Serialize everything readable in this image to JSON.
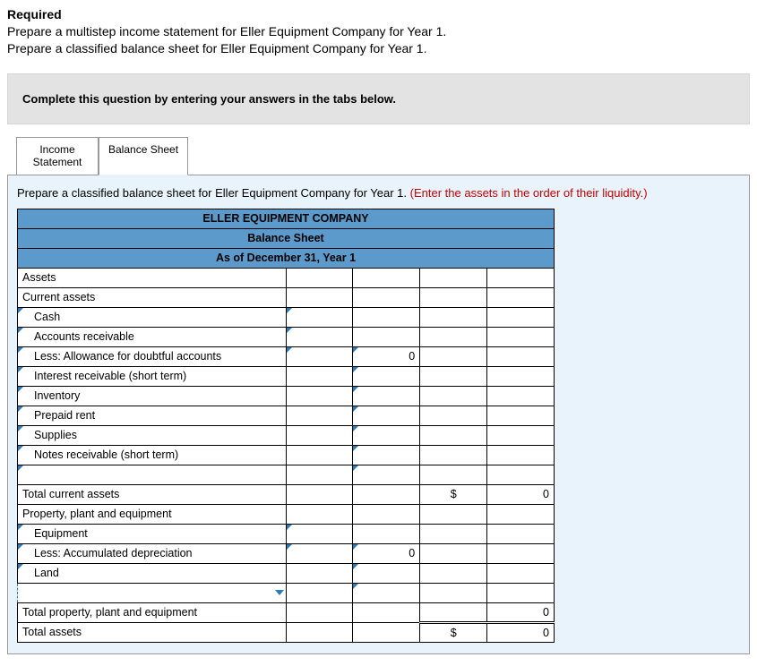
{
  "required": {
    "heading": "Required",
    "line1": "Prepare a multistep income statement for Eller Equipment Company for Year 1.",
    "line2": "Prepare a classified balance sheet for Eller Equipment Company for Year 1."
  },
  "instruction": "Complete this question by entering your answers in the tabs below.",
  "tabs": {
    "income": "Income Statement",
    "balance": "Balance Sheet"
  },
  "panel_prompt": "Prepare a classified balance sheet for Eller Equipment Company for Year 1. ",
  "panel_prompt_red": "(Enter the assets in the order of their liquidity.)",
  "headers": {
    "company": "ELLER EQUIPMENT COMPANY",
    "title": "Balance Sheet",
    "asof": "As of December 31, Year 1"
  },
  "rows": {
    "assets": "Assets",
    "current_assets": "Current assets",
    "cash": "Cash",
    "ar": "Accounts receivable",
    "less_allow": "Less: Allowance for doubtful accounts",
    "int_recv": "Interest receivable (short term)",
    "inventory": "Inventory",
    "prepaid_rent": "Prepaid rent",
    "supplies": "Supplies",
    "notes_recv": "Notes receivable (short term)",
    "total_current": "Total current assets",
    "ppe": "Property, plant and equipment",
    "equipment": "Equipment",
    "less_dep": "Less: Accumulated depreciation",
    "land": "Land",
    "total_ppe": "Total property, plant and equipment",
    "total_assets": "Total assets"
  },
  "values": {
    "less_allow_c2": "0",
    "total_current_sym": "$",
    "total_current_val": "0",
    "less_dep_c2": "0",
    "total_ppe_val": "0",
    "total_assets_sym": "$",
    "total_assets_val": "0"
  }
}
